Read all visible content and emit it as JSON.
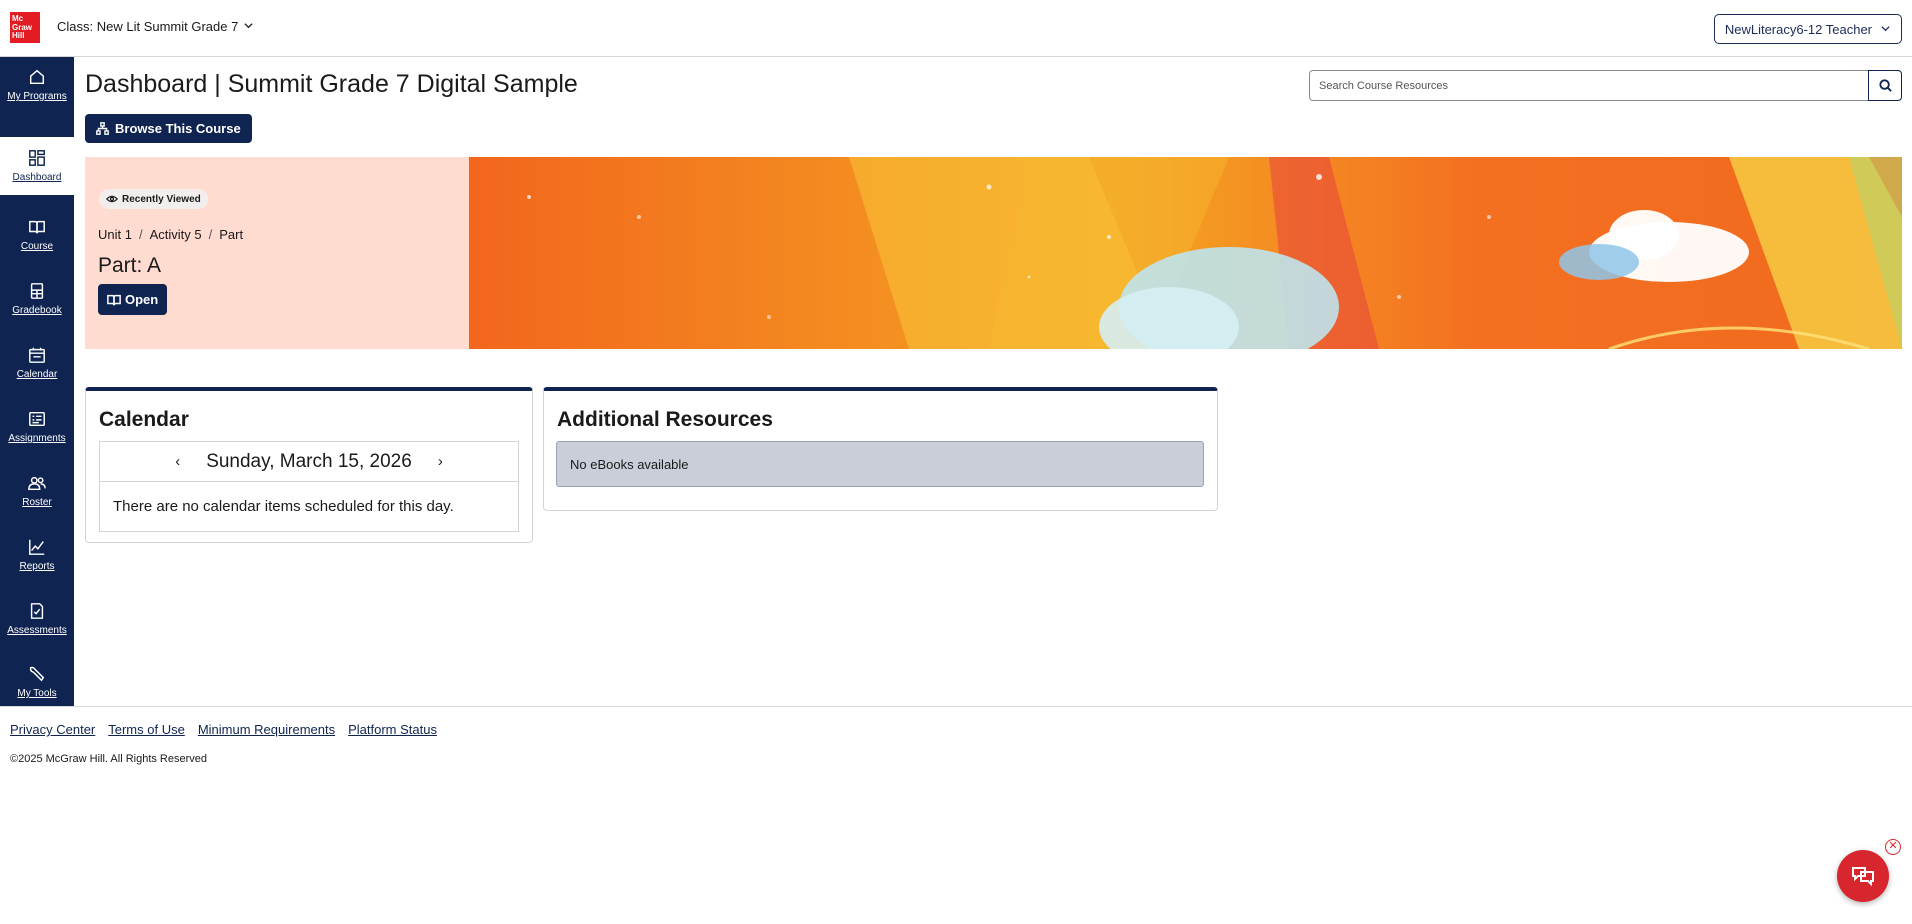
{
  "header": {
    "logo_lines": [
      "Mc",
      "Graw",
      "Hill"
    ],
    "class_label": "Class: New Lit Summit Grade 7",
    "user_label": "NewLiteracy6-12 Teacher"
  },
  "sidebar": {
    "items": [
      {
        "label": "My Programs",
        "icon": "home-icon"
      },
      {
        "label": "Dashboard",
        "icon": "dashboard-icon",
        "active": true
      },
      {
        "label": "Course",
        "icon": "book-icon"
      },
      {
        "label": "Gradebook",
        "icon": "gradebook-icon"
      },
      {
        "label": "Calendar",
        "icon": "calendar-icon"
      },
      {
        "label": "Assignments",
        "icon": "assignments-icon"
      },
      {
        "label": "Roster",
        "icon": "roster-icon"
      },
      {
        "label": "Reports",
        "icon": "reports-icon"
      },
      {
        "label": "Assessments",
        "icon": "assessments-icon"
      },
      {
        "label": "My Tools",
        "icon": "tools-icon"
      }
    ]
  },
  "main": {
    "page_title": "Dashboard | Summit Grade 7 Digital Sample",
    "browse_label": "Browse This Course",
    "search_placeholder": "Search Course Resources"
  },
  "hero": {
    "badge": "Recently Viewed",
    "breadcrumb": [
      "Unit 1",
      "Activity 5",
      "Part"
    ],
    "breadcrumb_sep": "/",
    "part_title": "Part: A",
    "open_label": "Open"
  },
  "calendar": {
    "title": "Calendar",
    "date": "Sunday, March 15, 2026",
    "empty_message": "There are no calendar items scheduled for this day."
  },
  "resources": {
    "title": "Additional Resources",
    "message": "No eBooks available"
  },
  "footer": {
    "links": [
      "Privacy Center",
      "Terms of Use",
      "Minimum Requirements",
      "Platform Status"
    ],
    "copyright": "©2025 McGraw Hill. All Rights Reserved"
  },
  "colors": {
    "brand_navy": "#0f2451",
    "brand_red": "#e31b23",
    "hero_panel": "#ffdbd0",
    "hero_orange": "#f26a1f"
  }
}
